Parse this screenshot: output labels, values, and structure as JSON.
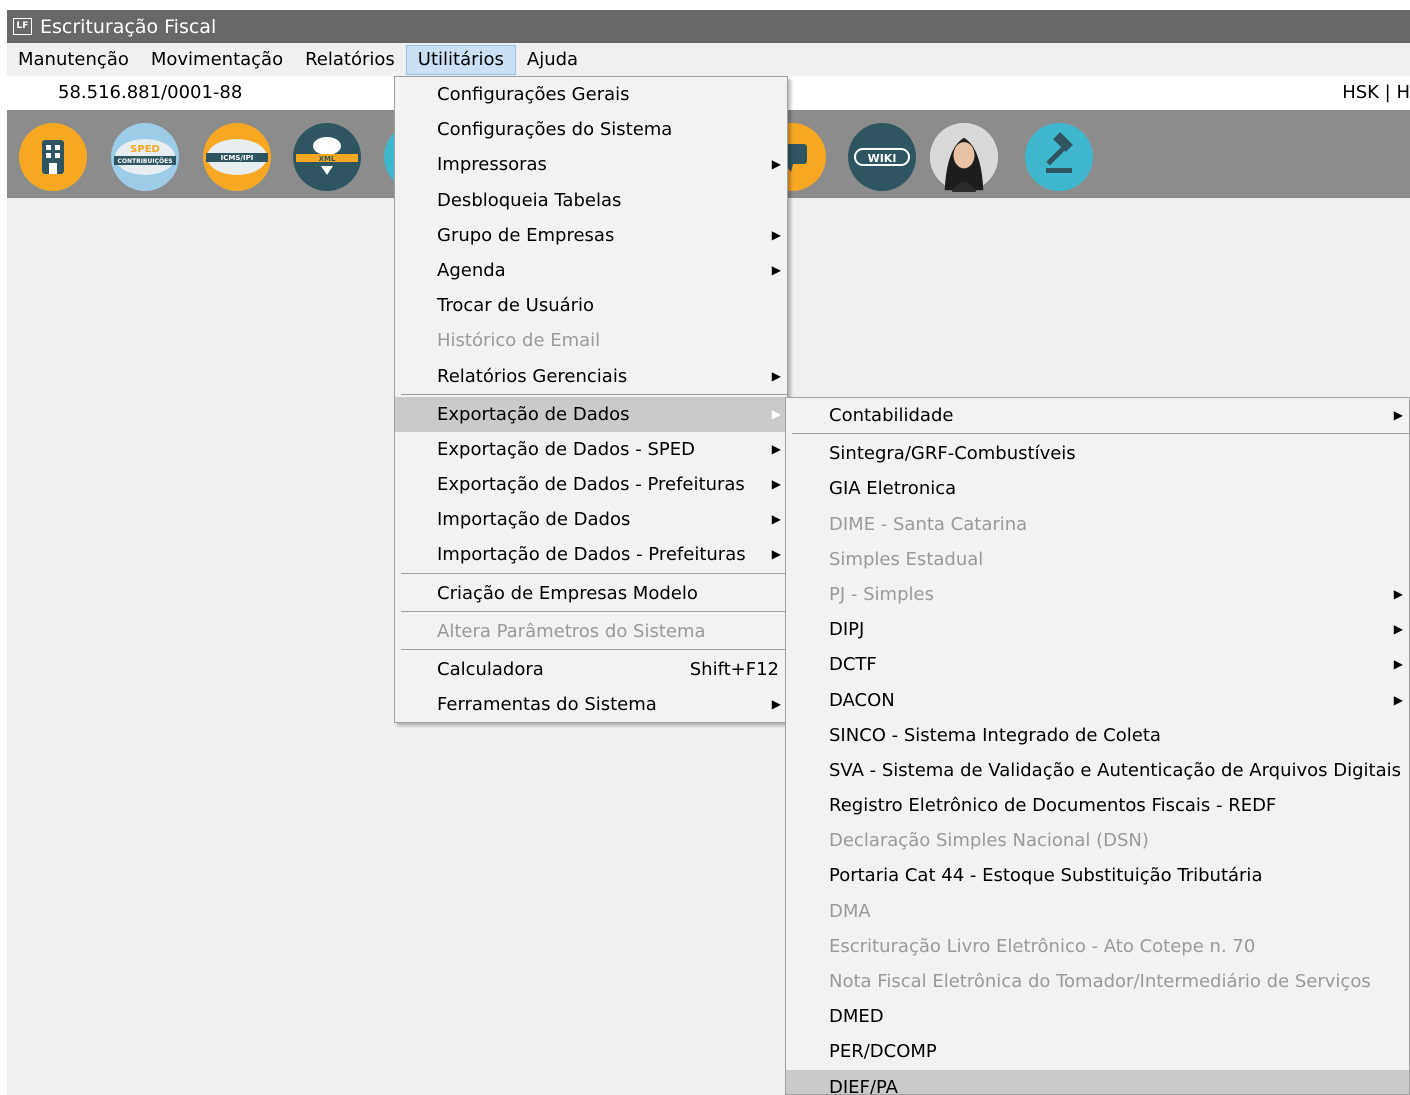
{
  "window": {
    "title": "Escrituração Fiscal",
    "icon_text": "LF"
  },
  "menubar": [
    {
      "label": "Manutenção",
      "active": false
    },
    {
      "label": "Movimentação",
      "active": false
    },
    {
      "label": "Relatórios",
      "active": false
    },
    {
      "label": "Utilitários",
      "active": true
    },
    {
      "label": "Ajuda",
      "active": false
    }
  ],
  "infobar": {
    "cnpj": "58.516.881/0001-88",
    "user": "HSK | H"
  },
  "toolbar": {
    "buttons": [
      {
        "icon": "building-icon",
        "color": "#f7a823"
      },
      {
        "icon": "sped-contribuicoes-icon",
        "color": "#9dcde6",
        "label_top": "SPED",
        "label_bottom": "CONTRIBUIÇÕES"
      },
      {
        "icon": "icms-ipi-icon",
        "color": "#f7a823",
        "label": "ICMS/IPI"
      },
      {
        "icon": "xml-cloud-icon",
        "color": "#2f5560",
        "label": "XML"
      },
      {
        "icon": "chat-icon",
        "color": "#f7a823"
      },
      {
        "icon": "wiki-icon",
        "color": "#2f5560",
        "label": "WIKI"
      },
      {
        "icon": "assistant-avatar-icon",
        "color": "#d9d9d9"
      },
      {
        "icon": "gavel-icon",
        "color": "#3fb7cf"
      }
    ]
  },
  "utilitarios_menu": {
    "items": [
      {
        "label": "Configurações Gerais"
      },
      {
        "label": "Configurações do Sistema"
      },
      {
        "label": "Impressoras",
        "submenu": true
      },
      {
        "label": "Desbloqueia Tabelas"
      },
      {
        "label": "Grupo de Empresas",
        "submenu": true
      },
      {
        "label": "Agenda",
        "submenu": true
      },
      {
        "label": "Trocar de Usuário"
      },
      {
        "label": "Histórico de Email",
        "disabled": true
      },
      {
        "label": "Relatórios Gerenciais",
        "submenu": true
      },
      {
        "separator": true
      },
      {
        "label": "Exportação de Dados",
        "submenu": true,
        "highlight": true
      },
      {
        "label": "Exportação de Dados - SPED",
        "submenu": true
      },
      {
        "label": "Exportação de Dados - Prefeituras",
        "submenu": true
      },
      {
        "label": "Importação de Dados",
        "submenu": true
      },
      {
        "label": "Importação de Dados - Prefeituras",
        "submenu": true
      },
      {
        "separator": true
      },
      {
        "label": "Criação de Empresas Modelo"
      },
      {
        "separator": true
      },
      {
        "label": "Altera Parâmetros do Sistema",
        "disabled": true
      },
      {
        "separator": true
      },
      {
        "label": "Calculadora",
        "shortcut": "Shift+F12"
      },
      {
        "label": "Ferramentas do Sistema",
        "submenu": true
      }
    ]
  },
  "exportacao_submenu": {
    "items": [
      {
        "label": "Contabilidade",
        "submenu": true
      },
      {
        "separator": true
      },
      {
        "label": "Sintegra/GRF-Combustíveis"
      },
      {
        "label": "GIA Eletronica"
      },
      {
        "label": "DIME - Santa Catarina",
        "disabled": true
      },
      {
        "label": "Simples Estadual",
        "disabled": true
      },
      {
        "label": "PJ - Simples",
        "disabled": true,
        "submenu": true
      },
      {
        "label": "DIPJ",
        "submenu": true
      },
      {
        "label": "DCTF",
        "submenu": true
      },
      {
        "label": "DACON",
        "submenu": true
      },
      {
        "label": "SINCO - Sistema Integrado de Coleta"
      },
      {
        "label": "SVA - Sistema de Validação e Autenticação de Arquivos Digitais"
      },
      {
        "label": "Registro Eletrônico de Documentos Fiscais - REDF"
      },
      {
        "label": "Declaração Simples Nacional (DSN)",
        "disabled": true
      },
      {
        "label": "Portaria Cat 44 - Estoque Substituição Tributária"
      },
      {
        "label": "DMA",
        "disabled": true
      },
      {
        "label": "Escrituração Livro Eletrônico - Ato Cotepe n. 70",
        "disabled": true
      },
      {
        "label": "Nota Fiscal Eletrônica do Tomador/Intermediário de Serviços",
        "disabled": true
      },
      {
        "label": "DMED"
      },
      {
        "label": "PER/DCOMP"
      },
      {
        "label": "DIEF/PA",
        "highlight": true
      }
    ]
  }
}
